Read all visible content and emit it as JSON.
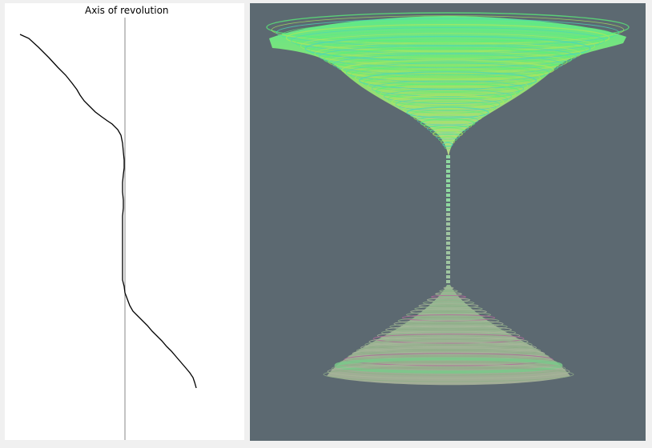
{
  "drawing_panel": {
    "axis_label": "Axis of revolution",
    "background": "#ffffff",
    "axis_color": "#8a8a8a",
    "profile_color": "#000000"
  },
  "view_panel": {
    "background": "#5c6971",
    "upper_shape_colors": [
      "#59f07a",
      "#a8e85e",
      "#49d8b8",
      "#7a5aa8"
    ],
    "lower_shape_colors": [
      "#a8b79a",
      "#79c98a",
      "#b06a9a",
      "#8fae88"
    ]
  }
}
